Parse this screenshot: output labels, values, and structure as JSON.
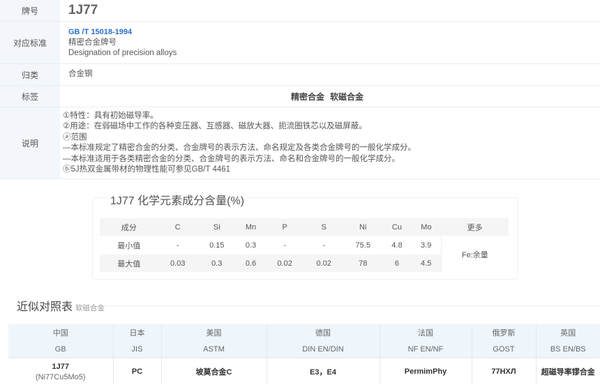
{
  "info": {
    "grade_label": "牌号",
    "grade": "1J77",
    "standard_label": "对应标准",
    "standard_code": "GB /T 15018-1994",
    "standard_name_cn": "精密合金牌号",
    "standard_name_en": "Designation of precision alloys",
    "category_label": "归类",
    "category": "合金钢",
    "tags_label": "标签",
    "tags": [
      "精密合金",
      "软磁合金"
    ],
    "desc_label": "说明",
    "desc_lines": [
      "①特性：具有初始磁导率。",
      "②用途：在弱磁场中工作的各种变压器、互感器、磁放大器、扼流圈铁芯以及磁屏蔽。",
      "ⓐ范围",
      "—本标准规定了精密合金的分类、合金牌号的表示方法、命名规定及各类合金牌号的一般化学成分。",
      "—本标准适用于各类精密合金的分类、合金牌号的表示方法、命名和合金牌号的一般化学成分。",
      "ⓑ5J热双金属带材的物理性能可参见GB/T 4461"
    ]
  },
  "chem": {
    "title": "1J77 化学元素成分含量(%)",
    "header": [
      "成分",
      "C",
      "Si",
      "Mn",
      "P",
      "S",
      "Ni",
      "Cu",
      "Mo",
      "更多"
    ],
    "min_row": [
      "最小值",
      "-",
      "0.15",
      "0.3",
      "-",
      "-",
      "75.5",
      "4.8",
      "3.9"
    ],
    "max_row": [
      "最大值",
      "0.03",
      "0.3",
      "0.6",
      "0.02",
      "0.02",
      "78",
      "6",
      "4.5"
    ],
    "more_value": "Fe:余量"
  },
  "compare": {
    "title": "近似对照表",
    "subtitle": "软磁合金",
    "countries": [
      "中国",
      "日本",
      "美国",
      "德国",
      "法国",
      "俄罗斯",
      "英国"
    ],
    "standards": [
      "GB",
      "JIS",
      "ASTM",
      "DIN EN/DIN",
      "NF EN/NF",
      "GOST",
      "BS EN/BS"
    ],
    "grades": [
      "1J77",
      "PC",
      "坡莫合金C",
      "E3，E4",
      "PermimPhy",
      "77НХЛ",
      "超磁导率镠合金"
    ],
    "grade_note": "(Ni77Cu5Mo5)"
  }
}
